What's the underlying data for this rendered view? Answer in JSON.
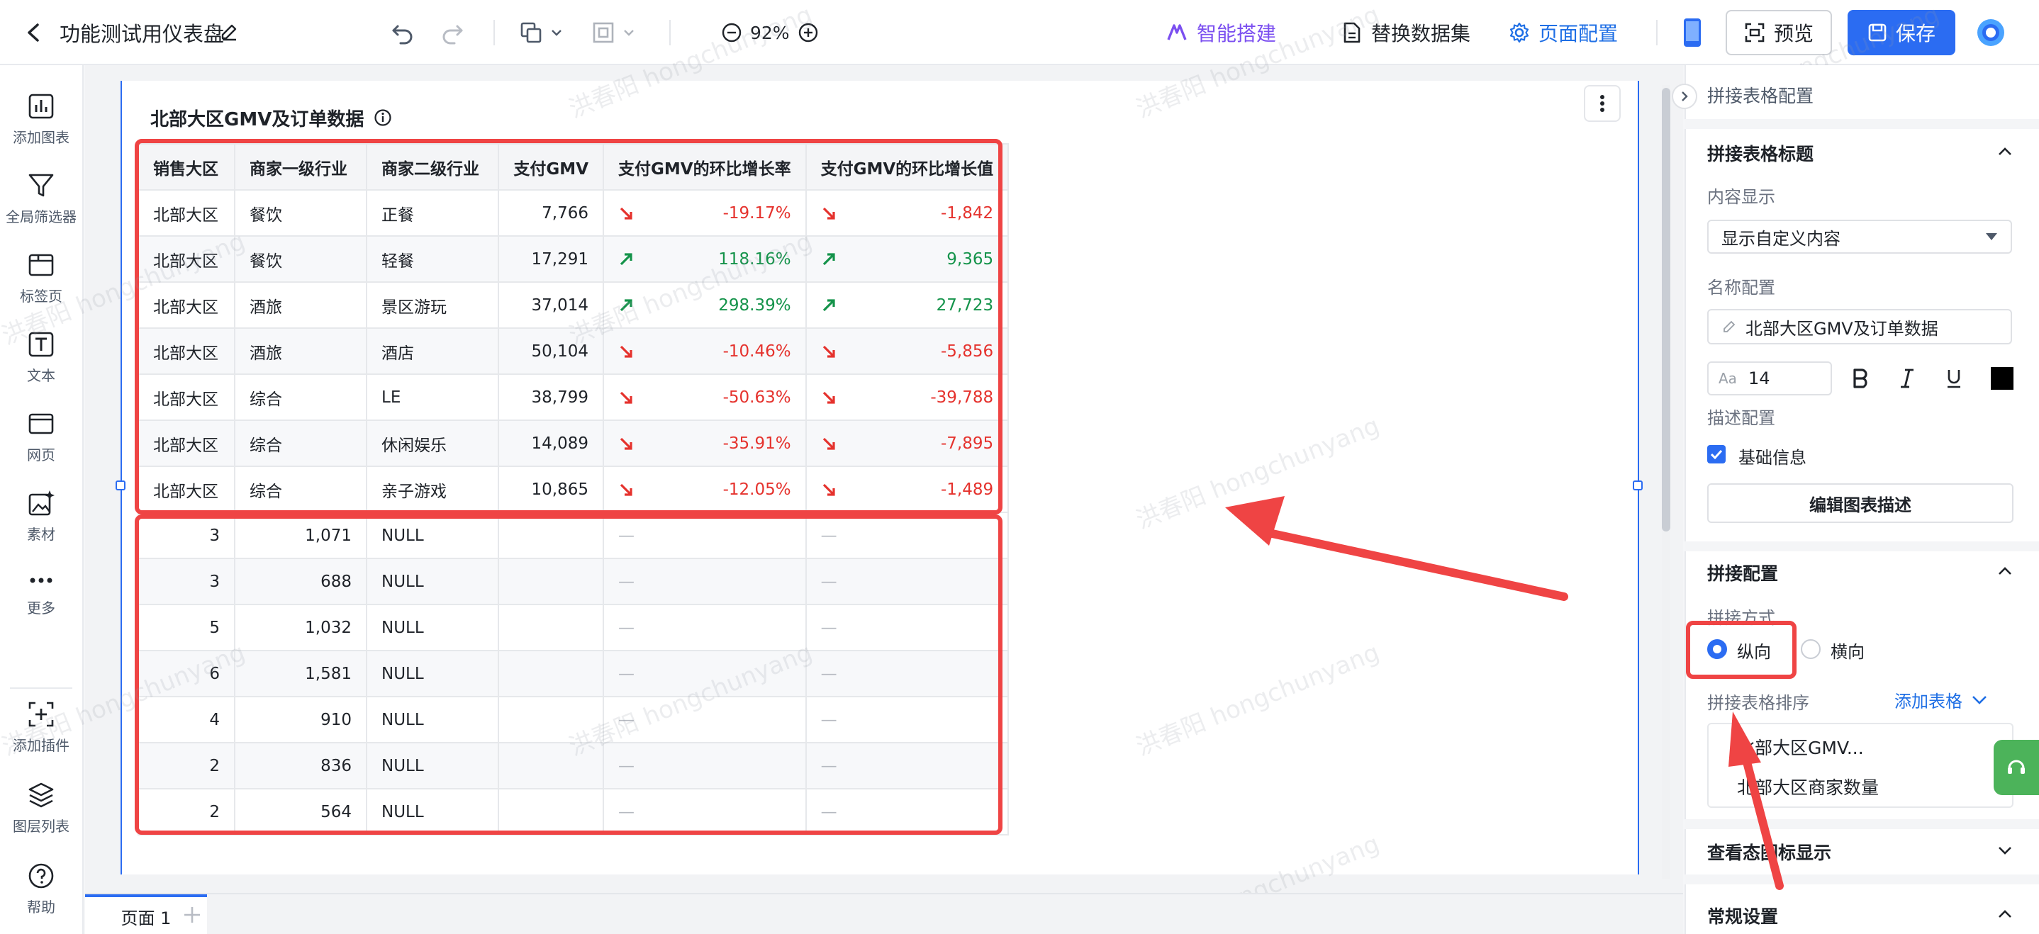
{
  "header": {
    "dashboard_title": "功能测试用仪表盘",
    "zoom": "92%",
    "ai_build_label": "智能搭建",
    "replace_dataset_label": "替换数据集",
    "page_config_label": "页面配置",
    "preview_label": "预览",
    "save_label": "保存"
  },
  "left_rail": {
    "items": [
      {
        "label": "添加图表",
        "icon": "bar-chart-icon"
      },
      {
        "label": "全局筛选器",
        "icon": "filter-icon"
      },
      {
        "label": "标签页",
        "icon": "tab-page-icon"
      },
      {
        "label": "文本",
        "icon": "text-icon"
      },
      {
        "label": "网页",
        "icon": "web-page-icon"
      },
      {
        "label": "素材",
        "icon": "material-icon"
      },
      {
        "label": "更多",
        "icon": "more-dots-icon"
      },
      {
        "label": "添加插件",
        "icon": "add-plugin-icon"
      },
      {
        "label": "图层列表",
        "icon": "layers-icon"
      },
      {
        "label": "帮助",
        "icon": "help-icon"
      }
    ]
  },
  "chart": {
    "title": "北部大区GMV及订单数据",
    "columns": [
      "销售大区",
      "商家一级行业",
      "商家二级行业",
      "支付GMV",
      "支付GMV的环比增长率",
      "支付GMV的环比增长值"
    ],
    "rows": [
      {
        "region": "北部大区",
        "l1": "餐饮",
        "l2": "正餐",
        "gmv": "7,766",
        "rate": "-19.17%",
        "value": "-1,842",
        "trend": "down"
      },
      {
        "region": "北部大区",
        "l1": "餐饮",
        "l2": "轻餐",
        "gmv": "17,291",
        "rate": "118.16%",
        "value": "9,365",
        "trend": "up"
      },
      {
        "region": "北部大区",
        "l1": "酒旅",
        "l2": "景区游玩",
        "gmv": "37,014",
        "rate": "298.39%",
        "value": "27,723",
        "trend": "up"
      },
      {
        "region": "北部大区",
        "l1": "酒旅",
        "l2": "酒店",
        "gmv": "50,104",
        "rate": "-10.46%",
        "value": "-5,856",
        "trend": "down"
      },
      {
        "region": "北部大区",
        "l1": "综合",
        "l2": "LE",
        "gmv": "38,799",
        "rate": "-50.63%",
        "value": "-39,788",
        "trend": "down"
      },
      {
        "region": "北部大区",
        "l1": "综合",
        "l2": "休闲娱乐",
        "gmv": "14,089",
        "rate": "-35.91%",
        "value": "-7,895",
        "trend": "down"
      },
      {
        "region": "北部大区",
        "l1": "综合",
        "l2": "亲子游戏",
        "gmv": "10,865",
        "rate": "-12.05%",
        "value": "-1,489",
        "trend": "down"
      }
    ],
    "rows2": [
      {
        "a": "3",
        "b": "1,071",
        "c": "NULL",
        "e": "—",
        "f": "—"
      },
      {
        "a": "3",
        "b": "688",
        "c": "NULL",
        "e": "—",
        "f": "—"
      },
      {
        "a": "5",
        "b": "1,032",
        "c": "NULL",
        "e": "—",
        "f": "—"
      },
      {
        "a": "6",
        "b": "1,581",
        "c": "NULL",
        "e": "—",
        "f": "—"
      },
      {
        "a": "4",
        "b": "910",
        "c": "NULL",
        "e": "—",
        "f": "—"
      },
      {
        "a": "2",
        "b": "836",
        "c": "NULL",
        "e": "—",
        "f": "—"
      },
      {
        "a": "2",
        "b": "564",
        "c": "NULL",
        "e": "—",
        "f": "—"
      }
    ],
    "colors": {
      "negative": "#e5322d",
      "positive": "#14934a",
      "highlight": "#ef4444"
    }
  },
  "footer": {
    "page_tab": "页面 1"
  },
  "watermark_text": "洪春阳 hongchunyang",
  "right_panel": {
    "panel_title": "拼接表格配置",
    "title_section": {
      "heading": "拼接表格标题",
      "content_display_label": "内容显示",
      "content_display_value": "显示自定义内容",
      "name_config_label": "名称配置",
      "name_value": "北部大区GMV及订单数据",
      "font_size": "14",
      "desc_config_label": "描述配置",
      "basic_info_label": "基础信息",
      "edit_desc_button": "编辑图表描述"
    },
    "join_section": {
      "heading": "拼接配置",
      "join_method_label": "拼接方式",
      "vertical_label": "纵向",
      "horizontal_label": "横向",
      "selected": "纵向",
      "sort_label": "拼接表格排序",
      "add_table_label": "添加表格",
      "tables": [
        "北部大区GMV...",
        "北部大区商家数量"
      ]
    },
    "view_icon_section": "查看态图标显示",
    "general_section": "常规设置"
  }
}
